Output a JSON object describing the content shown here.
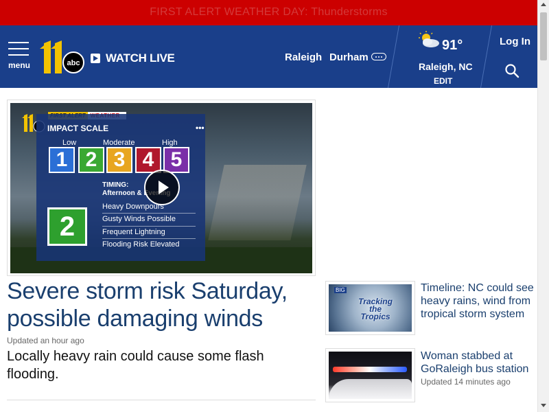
{
  "alert": {
    "text": "FIRST ALERT WEATHER DAY: Thunderstorms"
  },
  "header": {
    "menu_label": "menu",
    "logo_number": "11",
    "logo_network": "abc",
    "watch_live": "WATCH LIVE",
    "nav": [
      "Raleigh",
      "Durham"
    ],
    "weather": {
      "temp": "91°",
      "city": "Raleigh, NC",
      "edit": "EDIT",
      "icon": "partly-sunny-icon"
    },
    "login": "Log In"
  },
  "main_story": {
    "graphic": {
      "first_alert": "FIRST ALERT",
      "weather": "WEATHER",
      "title": "IMPACT SCALE",
      "menu_dots": "•••",
      "scale_labels": [
        "Low",
        "Moderate",
        "High"
      ],
      "levels": [
        "1",
        "2",
        "3",
        "4",
        "5"
      ],
      "level_colors": [
        "#2b6fd6",
        "#3aa832",
        "#e8a620",
        "#b0182d",
        "#7a2fa8"
      ],
      "timing_label": "TIMING:",
      "timing_value": "Afternoon & Evening",
      "current_level": "2",
      "impacts": [
        "Heavy Downpours",
        "Gusty Winds Possible",
        "Frequent Lightning",
        "Flooding Risk Elevated"
      ]
    },
    "headline": "Severe storm risk Saturday, possible damaging winds",
    "updated": "Updated an hour ago",
    "summary": "Locally heavy rain could cause some flash flooding."
  },
  "side_stories": [
    {
      "title": "Timeline: NC could see heavy rains, wind from tropical storm system",
      "meta": "",
      "thumb_text": "Tracking the Tropics",
      "thumb_badge": "BIG"
    },
    {
      "title": "Woman stabbed at GoRaleigh bus station",
      "meta": "Updated 14 minutes ago"
    }
  ]
}
